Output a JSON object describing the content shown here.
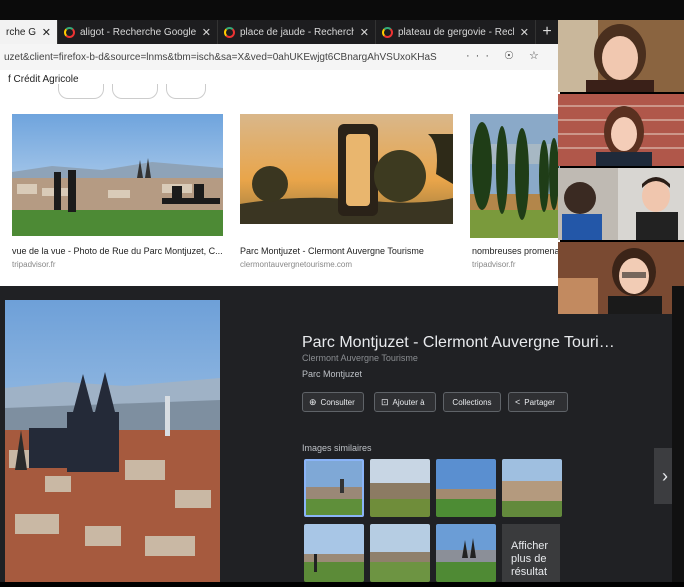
{
  "browser": {
    "tabs": [
      {
        "title": "rche G",
        "active": true
      },
      {
        "title": "aligot - Recherche Google",
        "active": false
      },
      {
        "title": "place de jaude - Recherche G",
        "active": false
      },
      {
        "title": "plateau de gergovie - Recher",
        "active": false
      }
    ],
    "tab_close": "✕",
    "new_tab": "+",
    "url": "uzet&client=firefox-b-d&source=lnms&tbm=isch&sa=X&ved=0ahUKEwjgt6CBnargAhVSUxoKHaS",
    "url_icons": "··· ☉ ☆",
    "bookmark": "f Crédit Agricole"
  },
  "results": [
    {
      "caption": "vue de la vue - Photo de Rue du Parc Montjuzet, C...",
      "source": "tripadvisor.fr"
    },
    {
      "caption": "Parc Montjuzet - Clermont Auvergne Tourisme",
      "source": "clermontauvergnetourisme.com"
    },
    {
      "caption": "nombreuses promena",
      "source": "tripadvisor.fr"
    }
  ],
  "panel": {
    "title": "Parc Montjuzet - Clermont Auvergne Touri…",
    "subtitle": "Clermont Auvergne Tourisme",
    "description": "Parc Montjuzet",
    "buttons": [
      {
        "label": "Consulter",
        "icon": "globe-icon"
      },
      {
        "label": "Ajouter à",
        "icon": "bookmark-icon"
      },
      {
        "label": "Collections",
        "icon": ""
      },
      {
        "label": "Partager",
        "icon": "share-icon"
      }
    ],
    "similar_label": "Images similaires",
    "more_label": "Afficher plus de résultat",
    "next_arrow": "›"
  },
  "colors": {
    "panel_bg": "#202124",
    "tab_bar": "#1d1d1f",
    "active_tab": "#f2f2f2"
  }
}
